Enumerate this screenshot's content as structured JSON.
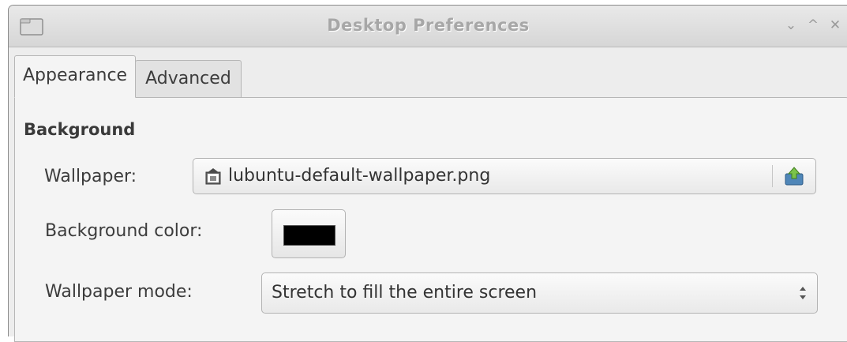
{
  "window": {
    "title": "Desktop Preferences",
    "controls": {
      "minimize": "⌄",
      "maximize": "^",
      "close": "✕"
    }
  },
  "tabs": [
    {
      "label": "Appearance",
      "active": true
    },
    {
      "label": "Advanced",
      "active": false
    }
  ],
  "background_section": {
    "title": "Background",
    "wallpaper": {
      "label": "Wallpaper:",
      "file_name": "lubuntu-default-wallpaper.png",
      "file_icon": "image-file-icon",
      "open_icon": "folder-open-icon"
    },
    "background_color": {
      "label": "Background color:",
      "color": "#000000"
    },
    "wallpaper_mode": {
      "label": "Wallpaper mode:",
      "selected": "Stretch to fill the entire screen"
    }
  },
  "colors": {
    "window_bg": "#ededed",
    "title_text": "#a7a7a7"
  }
}
